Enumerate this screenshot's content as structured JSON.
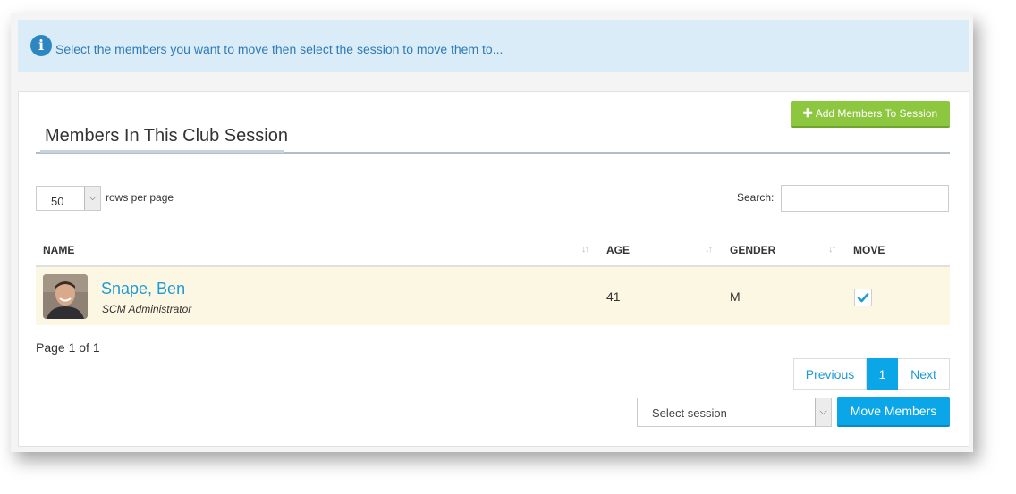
{
  "info": {
    "message": "Select the members you want to move then select the session to move them to...",
    "icon": "info-circle-icon"
  },
  "panel": {
    "title": "Members In This Club Session",
    "add_button_label": "Add Members To Session",
    "add_button_icon": "plus-icon"
  },
  "table_controls": {
    "rows_per_page_value": "50",
    "rows_per_page_label": "rows per page",
    "search_label": "Search:",
    "search_value": ""
  },
  "table": {
    "columns": [
      "NAME",
      "AGE",
      "GENDER",
      "MOVE"
    ],
    "rows": [
      {
        "name": "Snape, Ben",
        "role": "SCM Administrator",
        "age": "41",
        "gender": "M",
        "move_checked": true
      }
    ]
  },
  "pagination": {
    "page_info": "Page 1 of 1",
    "previous_label": "Previous",
    "current_page": "1",
    "next_label": "Next"
  },
  "move_controls": {
    "session_placeholder": "Select session",
    "move_button_label": "Move Members"
  },
  "colors": {
    "accent_blue": "#0ba6e8",
    "link_blue": "#1f9ad6",
    "add_green": "#8dc63f",
    "info_background": "#d9ecf7",
    "row_highlight": "#fcf7e2"
  }
}
